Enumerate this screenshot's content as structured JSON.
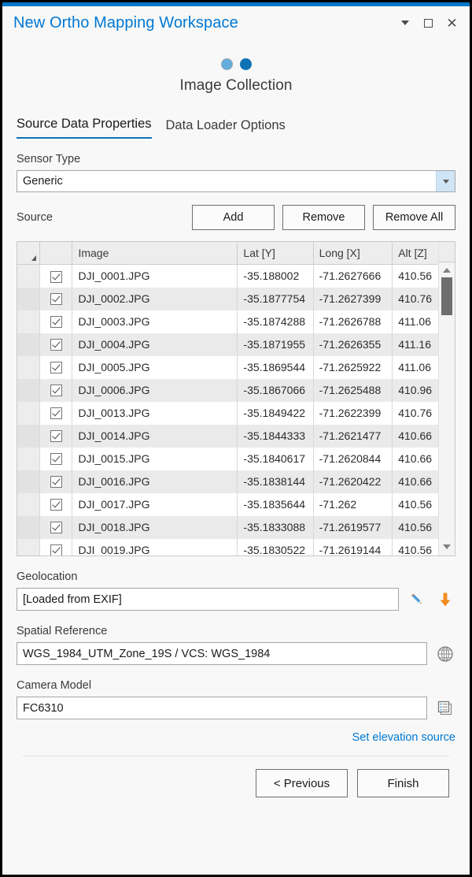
{
  "window": {
    "title": "New Ortho Mapping Workspace",
    "controls": {
      "menu_label": "▾",
      "maximize_label": "",
      "close_label": "✕"
    }
  },
  "wizard": {
    "step_title": "Image Collection",
    "steps": [
      {
        "label": "Step 1",
        "state": "done"
      },
      {
        "label": "Step 2",
        "state": "active"
      }
    ]
  },
  "tabs": [
    {
      "label": "Source Data Properties",
      "active": true
    },
    {
      "label": "Data Loader Options",
      "active": false
    }
  ],
  "sensor": {
    "label": "Sensor Type",
    "value": "Generic",
    "options": [
      "Generic"
    ]
  },
  "source": {
    "label": "Source",
    "add_label": "Add",
    "remove_label": "Remove",
    "remove_all_label": "Remove All"
  },
  "table": {
    "columns": [
      "Image",
      "Lat [Y]",
      "Long [X]",
      "Alt [Z]"
    ],
    "rows": [
      {
        "checked": true,
        "image": "DJI_0001.JPG",
        "lat": "-35.188002",
        "long": "-71.2627666",
        "alt": "410.56"
      },
      {
        "checked": true,
        "image": "DJI_0002.JPG",
        "lat": "-35.1877754",
        "long": "-71.2627399",
        "alt": "410.76"
      },
      {
        "checked": true,
        "image": "DJI_0003.JPG",
        "lat": "-35.1874288",
        "long": "-71.2626788",
        "alt": "411.06"
      },
      {
        "checked": true,
        "image": "DJI_0004.JPG",
        "lat": "-35.1871955",
        "long": "-71.2626355",
        "alt": "411.16"
      },
      {
        "checked": true,
        "image": "DJI_0005.JPG",
        "lat": "-35.1869544",
        "long": "-71.2625922",
        "alt": "411.06"
      },
      {
        "checked": true,
        "image": "DJI_0006.JPG",
        "lat": "-35.1867066",
        "long": "-71.2625488",
        "alt": "410.96"
      },
      {
        "checked": true,
        "image": "DJI_0013.JPG",
        "lat": "-35.1849422",
        "long": "-71.2622399",
        "alt": "410.76"
      },
      {
        "checked": true,
        "image": "DJI_0014.JPG",
        "lat": "-35.1844333",
        "long": "-71.2621477",
        "alt": "410.66"
      },
      {
        "checked": true,
        "image": "DJI_0015.JPG",
        "lat": "-35.1840617",
        "long": "-71.2620844",
        "alt": "410.66"
      },
      {
        "checked": true,
        "image": "DJI_0016.JPG",
        "lat": "-35.1838144",
        "long": "-71.2620422",
        "alt": "410.66"
      },
      {
        "checked": true,
        "image": "DJI_0017.JPG",
        "lat": "-35.1835644",
        "long": "-71.262",
        "alt": "410.56"
      },
      {
        "checked": true,
        "image": "DJI_0018.JPG",
        "lat": "-35.1833088",
        "long": "-71.2619577",
        "alt": "410.56"
      },
      {
        "checked": true,
        "image": "DJI_0019.JPG",
        "lat": "-35.1830522",
        "long": "-71.2619144",
        "alt": "410.56"
      }
    ]
  },
  "geolocation": {
    "label": "Geolocation",
    "value": "[Loaded from EXIF]",
    "placeholder": "",
    "edit_icon": "pencil-icon",
    "import_icon": "download-arrow-icon"
  },
  "spatial_reference": {
    "label": "Spatial Reference",
    "value": "WGS_1984_UTM_Zone_19S / VCS: WGS_1984",
    "placeholder": "",
    "picker_icon": "globe-icon"
  },
  "camera_model": {
    "label": "Camera Model",
    "value": "FC6310",
    "placeholder": "",
    "picker_icon": "document-list-icon"
  },
  "elevation_link": "Set elevation source",
  "footer": {
    "previous_label": "< Previous",
    "finish_label": "Finish"
  },
  "colors": {
    "accent": "#0076c8",
    "link": "#0078d4",
    "title": "#0078d4",
    "dot_active": "#0f72b5",
    "dot_done": "#64aede",
    "import_arrow": "#f28c1e"
  }
}
